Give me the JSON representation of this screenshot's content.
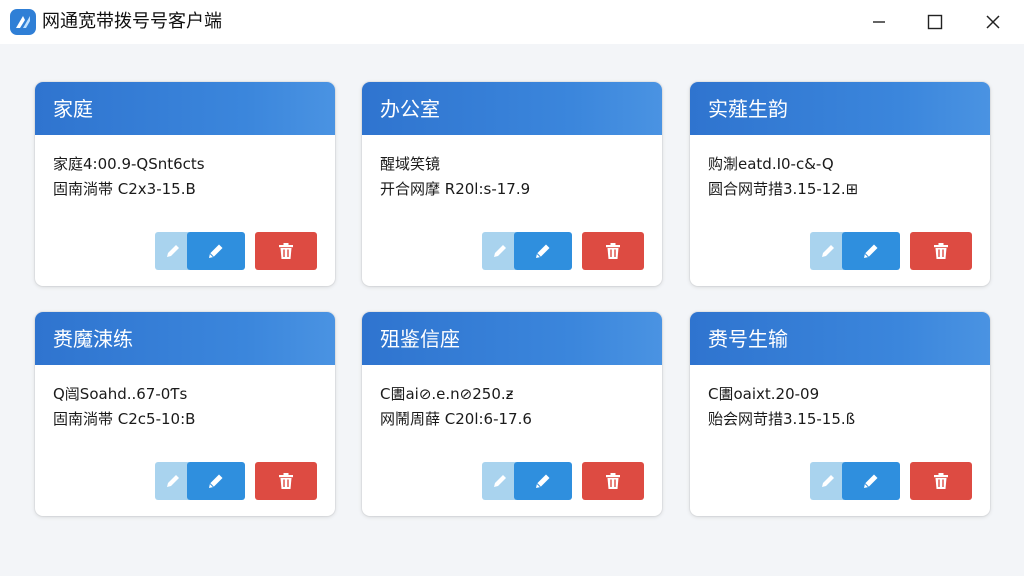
{
  "window": {
    "title": "网通宽带拨号号客户端",
    "controls": {
      "minimize_icon": "minimize-icon",
      "maximize_icon": "maximize-icon",
      "close_icon": "close-icon"
    }
  },
  "colors": {
    "header_blue": "#3b86dc",
    "edit_blue": "#2f8fde",
    "edit_light": "#a9d3ee",
    "delete_red": "#dd4b42"
  },
  "profiles": [
    {
      "title": "家庭",
      "line1": "家庭4:00.9-QSnt6cts",
      "line2": "固南淌帯 C2x3-15.B"
    },
    {
      "title": "办公室",
      "line1": "醒域笑镜",
      "line2": "开合网摩 R20l:s-17.9"
    },
    {
      "title": "实薤生韵",
      "line1": "购淛eatd.I0-c&-Q",
      "line2": "圆合网苛措3.15-12.⊞"
    },
    {
      "title": "赉魔涑练",
      "line1": "Q闿Soahd..67-0Ƭs",
      "line2": "固南淌帯 C2c5-10:B"
    },
    {
      "title": "殂鉴信座",
      "line1": "C圕ai⊘.e.n⊘250.ƶ",
      "line2": "网鬧周薛 C20l:6-17.6"
    },
    {
      "title": "赉号生输",
      "line1": "C圕oaixt.20-09",
      "line2": "贻会网苛措3.15-15.ß"
    }
  ],
  "buttons": {
    "edit_icon": "pencil-icon",
    "delete_icon": "trash-icon"
  }
}
